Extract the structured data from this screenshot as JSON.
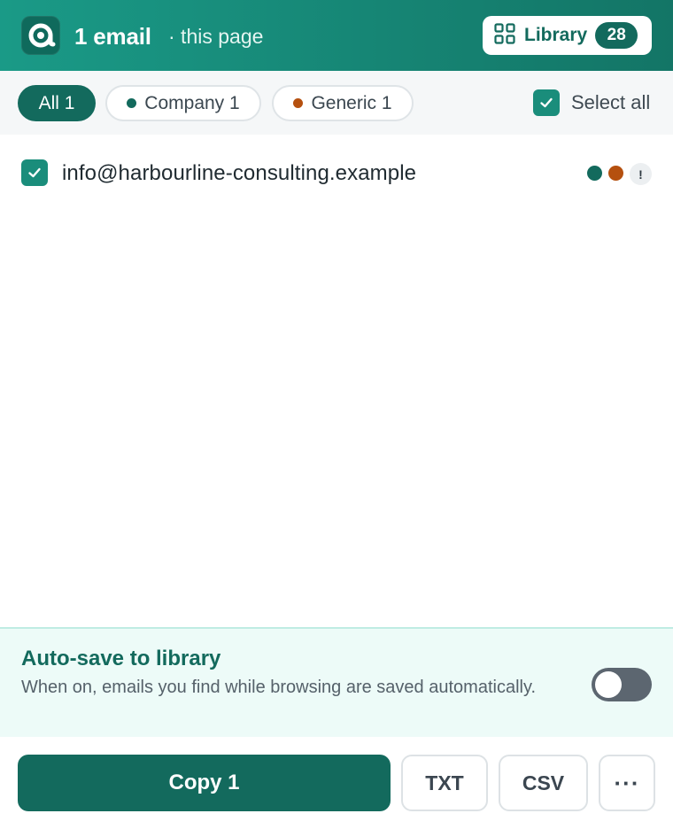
{
  "header": {
    "title_count": "1 email",
    "title_sub": "· this page",
    "library": {
      "label": "Library",
      "count": "28"
    }
  },
  "filters": {
    "all": {
      "label": "All 1"
    },
    "company": {
      "label": "Company 1",
      "color": "#136a5d"
    },
    "generic": {
      "label": "Generic 1",
      "color": "#b5500f"
    },
    "select_all": {
      "label": "Select all",
      "checked": true
    }
  },
  "emails": [
    {
      "address": "info@harbourline-consulting.example",
      "checked": true,
      "tags": [
        "company",
        "generic"
      ],
      "warning": "!"
    }
  ],
  "autosave": {
    "title": "Auto-save to library",
    "description": "When on, emails you find while browsing are saved automatically.",
    "enabled": false
  },
  "actions": {
    "copy": "Copy 1",
    "txt": "TXT",
    "csv": "CSV",
    "more": "···"
  },
  "colors": {
    "brand": "#136a5d",
    "company": "#136a5d",
    "generic": "#b5500f"
  }
}
